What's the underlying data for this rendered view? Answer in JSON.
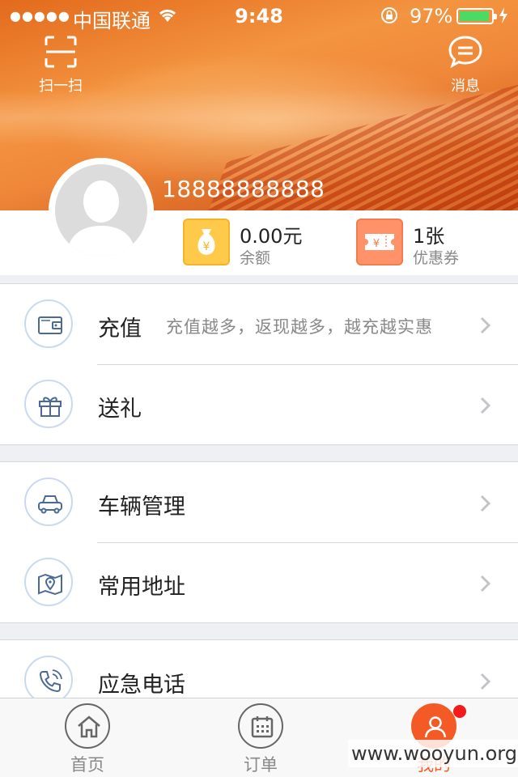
{
  "status_bar": {
    "signal": "●●●●●",
    "carrier": "中国联通",
    "time": "9:48",
    "battery_percent": "97%",
    "battery_level": 0.97
  },
  "header": {
    "scan_label": "扫一扫",
    "message_label": "消息"
  },
  "profile": {
    "phone": "18888888888",
    "balance_value": "0.00元",
    "balance_label": "余额",
    "coupon_value": "1张",
    "coupon_label": "优惠券"
  },
  "menu": {
    "groups": [
      {
        "items": [
          {
            "title": "充值",
            "subtitle": "充值越多，返现越多，越充越实惠",
            "icon": "wallet-icon"
          },
          {
            "title": "送礼",
            "subtitle": "",
            "icon": "gift-icon"
          }
        ]
      },
      {
        "items": [
          {
            "title": "车辆管理",
            "subtitle": "",
            "icon": "car-icon"
          },
          {
            "title": "常用地址",
            "subtitle": "",
            "icon": "map-pin-icon"
          }
        ]
      },
      {
        "items": [
          {
            "title": "应急电话",
            "subtitle": "",
            "icon": "phone-icon"
          }
        ]
      }
    ]
  },
  "tabbar": {
    "tabs": [
      {
        "label": "首页",
        "icon": "home-icon",
        "active": false
      },
      {
        "label": "订单",
        "icon": "calendar-icon",
        "active": false
      },
      {
        "label": "我的",
        "icon": "person-icon",
        "active": true
      }
    ]
  },
  "watermark": "www.wooyun.org",
  "colors": {
    "accent": "#f35a26",
    "balance_tile": "#ffc94a",
    "coupon_tile": "#ff9269",
    "icon_ring": "#c9daf0",
    "badge": "#f21a1a"
  }
}
